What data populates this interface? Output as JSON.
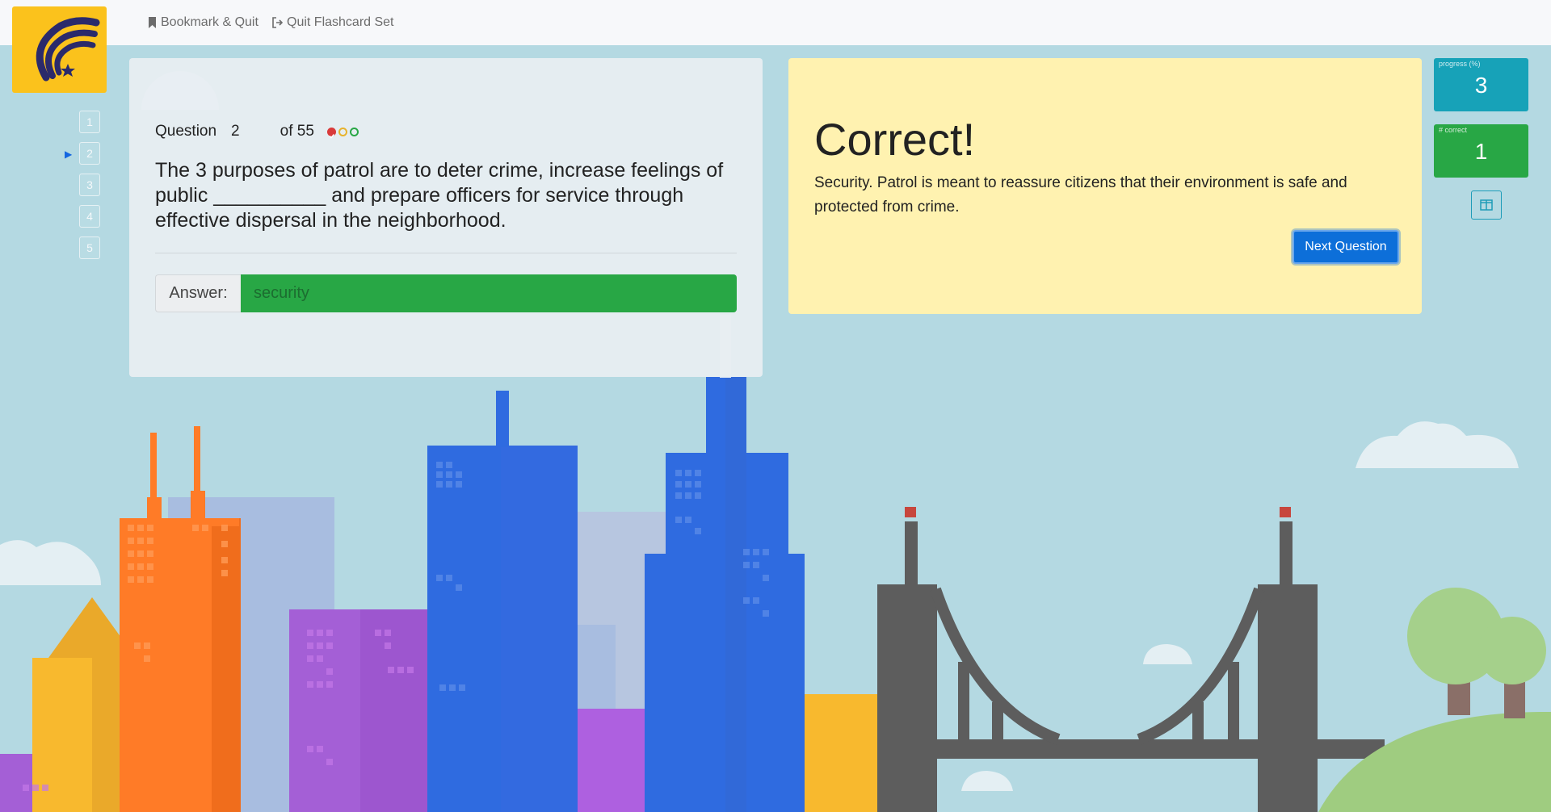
{
  "nav": {
    "bookmark_label": "Bookmark & Quit",
    "quit_label": "Quit Flashcard Set"
  },
  "question_nav": [
    "1",
    "2",
    "3",
    "4",
    "5"
  ],
  "question": {
    "label": "Question",
    "number": "2",
    "of_text": "of 55",
    "text": "The 3 purposes of patrol are to deter crime, increase feelings of public __________ and prepare officers for service through effective dispersal in the neighborhood.",
    "answer_label": "Answer:",
    "answer_value": "security"
  },
  "result": {
    "title": "Correct!",
    "explanation": "Security. Patrol is meant to reassure citizens that their environment is safe and protected from crime.",
    "next_label": "Next Question"
  },
  "stats": {
    "progress_label": "progress (%)",
    "progress_value": "3",
    "correct_label": "# correct",
    "correct_value": "1"
  },
  "colors": {
    "sky": "#b4d9e2",
    "logo": "#fbc21c",
    "answer_correct": "#28a745",
    "result_bg": "#fff2b0",
    "primary_button": "#0d6fd9",
    "progress_stat": "#17a2b8",
    "correct_stat": "#28a745",
    "dot_red": "#d93a3a",
    "dot_yellow": "#e7b22c",
    "dot_green": "#28a745"
  },
  "icons": {
    "logo": "wing-star-logo",
    "bookmark": "bookmark-icon",
    "quit": "sign-out-icon",
    "current_question": "caret-right-icon",
    "layout": "columns-icon"
  }
}
